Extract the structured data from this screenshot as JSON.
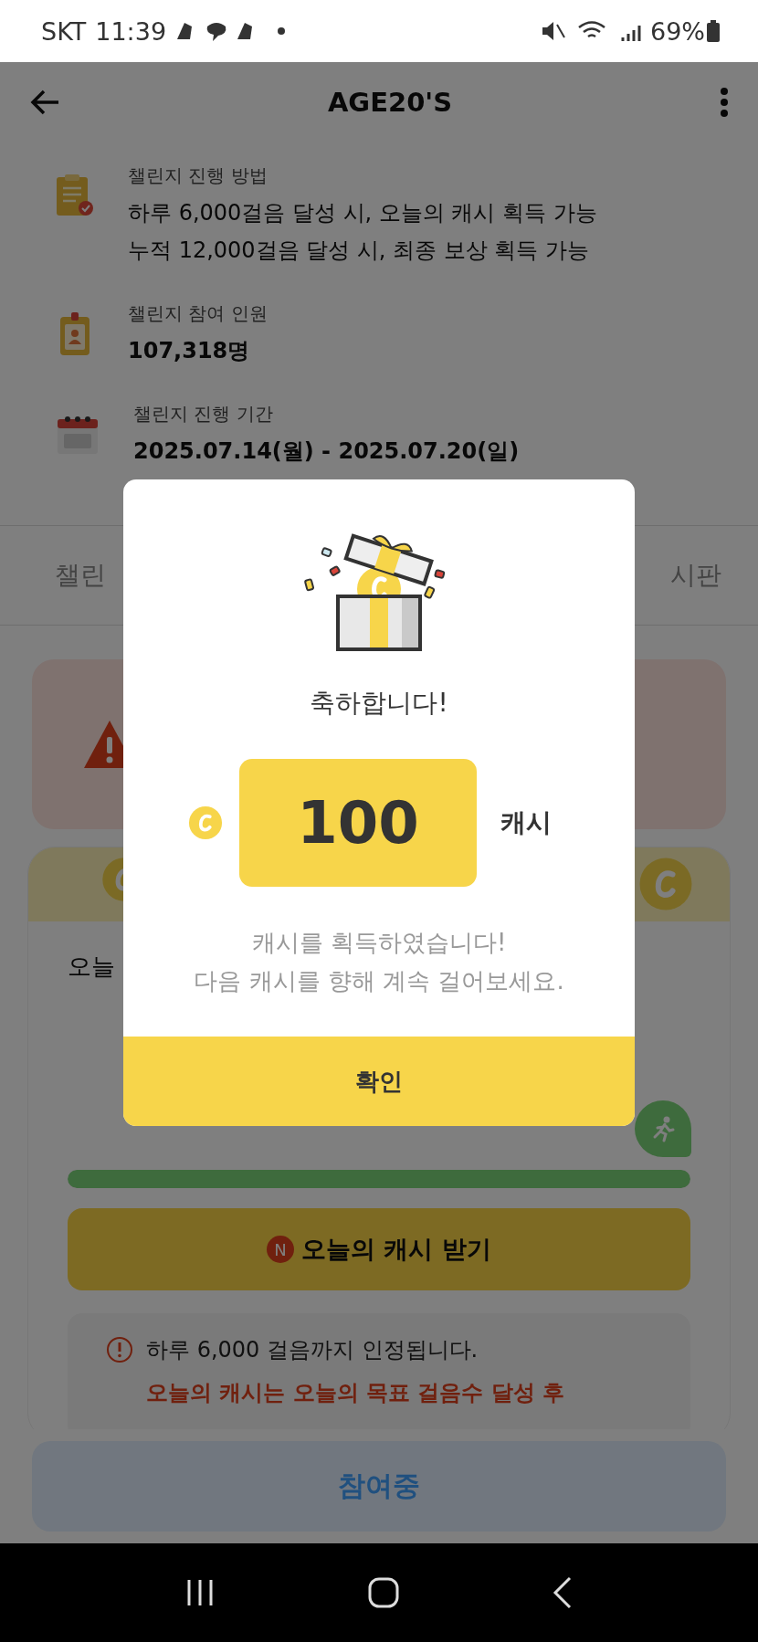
{
  "status_bar": {
    "carrier": "SKT",
    "time": "11:39",
    "battery": "69%"
  },
  "header": {
    "title": "AGE20'S"
  },
  "info": [
    {
      "kind": "method",
      "label": "챌린지 진행 방법",
      "lines": [
        "하루 6,000걸음 달성 시, 오늘의 캐시 획득 가능",
        "누적 12,000걸음 달성 시, 최종 보상 획득 가능"
      ]
    },
    {
      "kind": "participants",
      "label": "챌린지 참여 인원",
      "lines": [
        "107,318명"
      ]
    },
    {
      "kind": "period",
      "label": "챌린지 진행 기간",
      "lines": [
        "2025.07.14(월) - 2025.07.20(일)"
      ]
    }
  ],
  "tabs": [
    "챌린",
    "시판"
  ],
  "today_card": {
    "title": "오늘",
    "progress": {
      "level": 1
    },
    "claim_button": {
      "badge": "N",
      "label": "오늘의 캐시 받기"
    },
    "notice": {
      "text": "하루 6,000 걸음까지 인정됩니다.",
      "warning": [
        "오늘의 캐시는 오늘의 목표 걸음수 달성 후"
      ]
    }
  },
  "bottom_button": {
    "label": "참여중"
  },
  "modal": {
    "title": "축하합니다!",
    "amount": "100",
    "unit": "캐시",
    "message": [
      "캐시를 획득하였습니다!",
      "다음 캐시를 향해 계속 걸어보세요."
    ],
    "confirm": "확인"
  }
}
